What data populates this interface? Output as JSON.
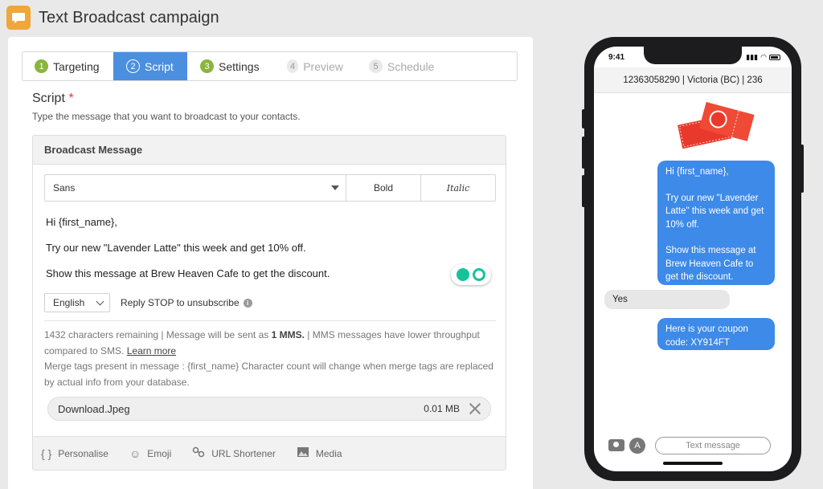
{
  "header": {
    "title": "Text Broadcast campaign",
    "icon": "chat-bubble-icon"
  },
  "steps": [
    {
      "num": "1",
      "label": "Targeting",
      "state": "done"
    },
    {
      "num": "2",
      "label": "Script",
      "state": "active"
    },
    {
      "num": "3",
      "label": "Settings",
      "state": "done"
    },
    {
      "num": "4",
      "label": "Preview",
      "state": "disabled"
    },
    {
      "num": "5",
      "label": "Schedule",
      "state": "disabled"
    }
  ],
  "script": {
    "title": "Script",
    "required_mark": "*",
    "subtitle": "Type the message that you want to broadcast to your contacts."
  },
  "panel": {
    "title": "Broadcast Message",
    "font": "Sans",
    "bold_label": "Bold",
    "italic_label": "Italic",
    "message": {
      "line1": "Hi {first_name},",
      "line2": "Try our new \"Lavender Latte\" this week and get 10% off.",
      "line3": "Show this message at Brew Heaven Cafe to get the discount."
    },
    "language": "English",
    "stop_text": "Reply STOP to unsubscribe",
    "info": {
      "remaining": "1432 characters remaining | Message will be sent as ",
      "mms_bold": "1 MMS.",
      "mms_note": " | MMS messages have lower throughput compared to SMS. ",
      "learn_more": "Learn more",
      "merge_note": "Merge tags present in message : {first_name} Character count will change when merge tags are replaced by actual info from your database."
    },
    "attachment": {
      "name": "Download.Jpeg",
      "size": "0.01 MB"
    },
    "footer": {
      "personalise": "Personalise",
      "emoji": "Emoji",
      "url_shortener": "URL Shortener",
      "media": "Media"
    }
  },
  "phone": {
    "time": "9:41",
    "header": "12363058290 | Victoria (BC) | 236",
    "bubble1": {
      "line1": "Hi {first_name},",
      "line2": "Try our new \"Lavender Latte\" this week and get 10% off.",
      "line3": "Show this message at Brew Heaven Cafe to get the discount."
    },
    "reply": "Yes",
    "bubble2": "Here is your coupon code: XY914FT",
    "input_placeholder": "Text message"
  },
  "colors": {
    "accent": "#4b8fdf",
    "done_step": "#8ab43f",
    "app_icon": "#f0a63b",
    "bubble_out": "#3d8ae8"
  }
}
